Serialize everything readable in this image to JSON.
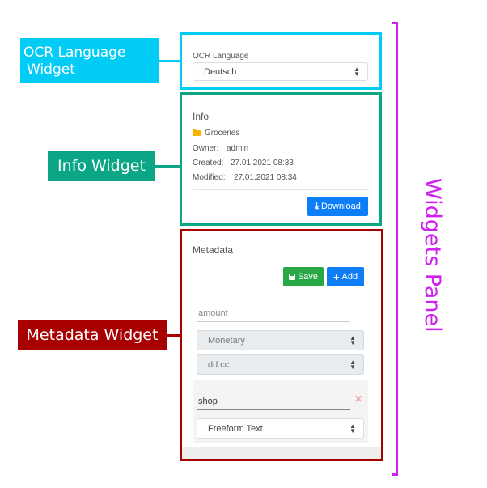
{
  "annotations": {
    "ocr_label_line1": "OCR Language",
    "ocr_label_line2": "Widget",
    "info_label": "Info Widget",
    "metadata_label": "Metadata Widget",
    "panel_label": "Widgets Panel",
    "colors": {
      "ocr": "#00ccf5",
      "info": "#0aa686",
      "metadata": "#a80000",
      "panel": "#d01ff0"
    }
  },
  "ocr_widget": {
    "label": "OCR Language",
    "selected": "Deutsch"
  },
  "info_widget": {
    "title": "Info",
    "folder_icon": "folder-icon",
    "folder": "Groceries",
    "owner_label": "Owner:",
    "owner": "admin",
    "created_label": "Created:",
    "created": "27.01.2021 08:33",
    "modified_label": "Modified:",
    "modified": "27.01.2021 08:34",
    "download_icon": "download-icon",
    "download_label": "Download"
  },
  "metadata_widget": {
    "title": "Metadata",
    "save_icon": "floppy-disk-icon",
    "save_label": "Save",
    "add_icon": "plus-icon",
    "add_label": "Add",
    "fields": [
      {
        "name": "amount",
        "type": "Monetary",
        "format": "dd.cc",
        "disabled": true
      },
      {
        "name": "shop",
        "type": "Freeform Text",
        "remove_icon": "close-icon"
      }
    ]
  }
}
